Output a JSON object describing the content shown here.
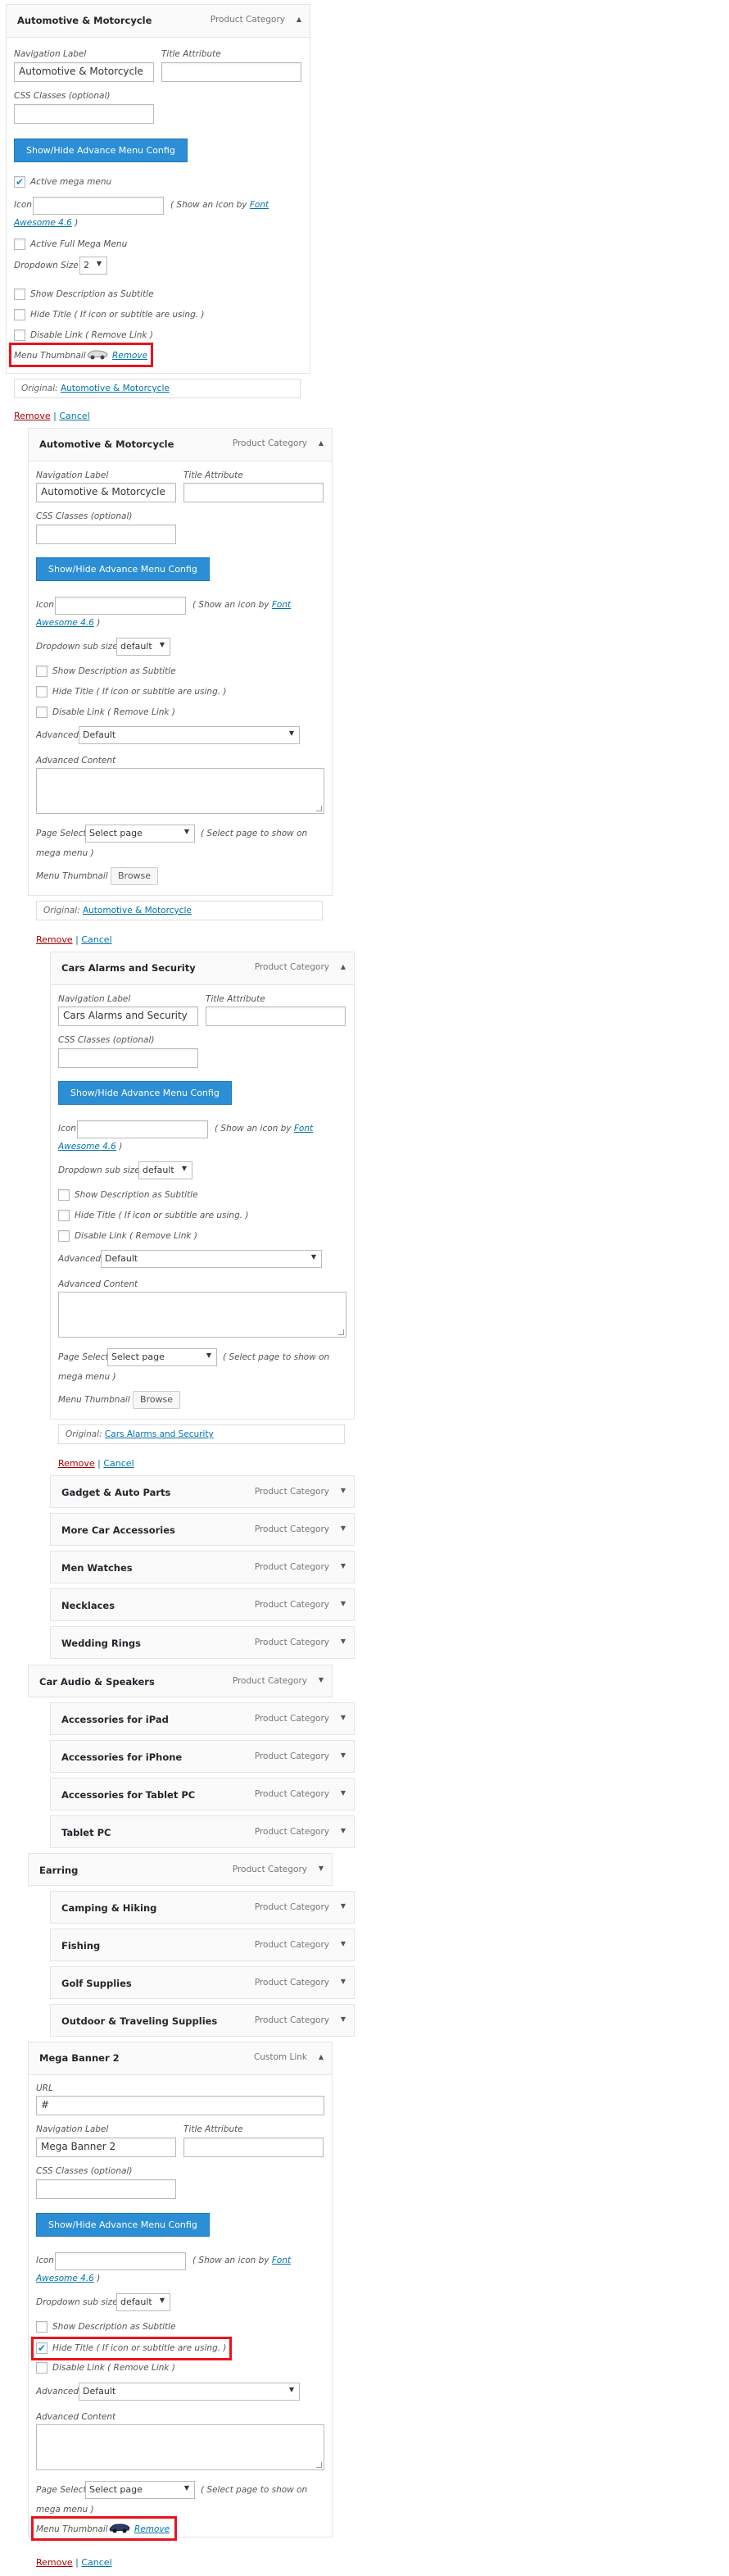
{
  "item1": {
    "title": "Automotive & Motorcycle",
    "type": "Product Category",
    "nav_label_caption": "Navigation Label",
    "nav_label_value": "Automotive & Motorcycle",
    "title_attr_caption": "Title Attribute",
    "css_caption": "CSS Classes (optional)",
    "config_button": "Show/Hide Advance Menu Config",
    "active_mega": "Active mega menu",
    "icon_caption": "Icon",
    "icon_hint_pre": "( Show an icon by",
    "icon_hint_link1": "Font",
    "icon_hint_link2": "Awesome 4.6",
    "icon_hint_post": ")",
    "active_full": "Active Full Mega Menu",
    "dropdown_size_caption": "Dropdown Size",
    "dropdown_size_value": "2",
    "show_desc": "Show Description as Subtitle",
    "hide_title": "Hide Title ( If icon or subtitle are using. )",
    "disable_link": "Disable Link ( Remove Link )",
    "thumb_caption": "Menu Thumbnail",
    "thumb_remove": "Remove",
    "original_caption": "Original:",
    "original_link": "Automotive & Motorcycle",
    "remove": "Remove",
    "sep": "|",
    "cancel": "Cancel"
  },
  "item2": {
    "title": "Automotive & Motorcycle",
    "type": "Product Category",
    "nav_label_caption": "Navigation Label",
    "nav_label_value": "Automotive & Motorcycle",
    "title_attr_caption": "Title Attribute",
    "css_caption": "CSS Classes (optional)",
    "config_button": "Show/Hide Advance Menu Config",
    "icon_caption": "Icon",
    "icon_hint_pre": "( Show an icon by",
    "icon_hint_link1": "Font",
    "icon_hint_link2": "Awesome 4.6",
    "icon_hint_post": ")",
    "dropdown_sub_caption": "Dropdown sub size",
    "dropdown_sub_value": "default",
    "show_desc": "Show Description as Subtitle",
    "hide_title": "Hide Title ( If icon or subtitle are using. )",
    "disable_link": "Disable Link ( Remove Link )",
    "advanced_caption": "Advanced",
    "advanced_value": "Default",
    "adv_content_caption": "Advanced Content",
    "page_select_caption": "Page Select",
    "page_select_value": "Select page",
    "page_select_hint1": "( Select page to show on",
    "page_select_hint2": "mega menu )",
    "thumb_caption": "Menu Thumbnail",
    "browse": "Browse",
    "original_caption": "Original:",
    "original_link": "Automotive & Motorcycle",
    "remove": "Remove",
    "sep": "|",
    "cancel": "Cancel"
  },
  "item3": {
    "title": "Cars Alarms and Security",
    "type": "Product Category",
    "nav_label_caption": "Navigation Label",
    "nav_label_value": "Cars Alarms and Security",
    "title_attr_caption": "Title Attribute",
    "css_caption": "CSS Classes (optional)",
    "config_button": "Show/Hide Advance Menu Config",
    "icon_caption": "Icon",
    "icon_hint_pre": "( Show an icon by",
    "icon_hint_link1": "Font",
    "icon_hint_link2": "Awesome 4.6",
    "icon_hint_post": ")",
    "dropdown_sub_caption": "Dropdown sub size",
    "dropdown_sub_value": "default",
    "show_desc": "Show Description as Subtitle",
    "hide_title": "Hide Title ( If icon or subtitle are using. )",
    "disable_link": "Disable Link ( Remove Link )",
    "advanced_caption": "Advanced",
    "advanced_value": "Default",
    "adv_content_caption": "Advanced Content",
    "page_select_caption": "Page Select",
    "page_select_value": "Select page",
    "page_select_hint1": "( Select page to show on",
    "page_select_hint2": "mega menu )",
    "thumb_caption": "Menu Thumbnail",
    "browse": "Browse",
    "original_caption": "Original:",
    "original_link": "Cars Alarms and Security",
    "remove": "Remove",
    "sep": "|",
    "cancel": "Cancel"
  },
  "collapsed": [
    {
      "title": "Gadget & Auto Parts",
      "type": "Product Category"
    },
    {
      "title": "More Car Accessories",
      "type": "Product Category"
    },
    {
      "title": "Men Watches",
      "type": "Product Category"
    },
    {
      "title": "Necklaces",
      "type": "Product Category"
    },
    {
      "title": "Wedding Rings",
      "type": "Product Category"
    },
    {
      "title": "Car Audio & Speakers",
      "type": "Product Category"
    },
    {
      "title": "Accessories for iPad",
      "type": "Product Category"
    },
    {
      "title": "Accessories for iPhone",
      "type": "Product Category"
    },
    {
      "title": "Accessories for Tablet PC",
      "type": "Product Category"
    },
    {
      "title": "Tablet PC",
      "type": "Product Category"
    },
    {
      "title": "Earring",
      "type": "Product Category"
    },
    {
      "title": "Camping & Hiking",
      "type": "Product Category"
    },
    {
      "title": "Fishing",
      "type": "Product Category"
    },
    {
      "title": "Golf Supplies",
      "type": "Product Category"
    },
    {
      "title": "Outdoor & Traveling Supplies",
      "type": "Product Category"
    }
  ],
  "item4": {
    "title": "Mega Banner 2",
    "type": "Custom Link",
    "url_caption": "URL",
    "url_value": "#",
    "nav_label_caption": "Navigation Label",
    "nav_label_value": "Mega Banner 2",
    "title_attr_caption": "Title Attribute",
    "css_caption": "CSS Classes (optional)",
    "config_button": "Show/Hide Advance Menu Config",
    "icon_caption": "Icon",
    "icon_hint_pre": "( Show an icon by",
    "icon_hint_link1": "Font",
    "icon_hint_link2": "Awesome 4.6",
    "icon_hint_post": ")",
    "dropdown_sub_caption": "Dropdown sub size",
    "dropdown_sub_value": "default",
    "show_desc": "Show Description as Subtitle",
    "hide_title": "Hide Title ( If icon or subtitle are using. )",
    "disable_link": "Disable Link ( Remove Link )",
    "advanced_caption": "Advanced",
    "advanced_value": "Default",
    "adv_content_caption": "Advanced Content",
    "page_select_caption": "Page Select",
    "page_select_value": "Select page",
    "page_select_hint1": "( Select page to show on",
    "page_select_hint2": "mega menu )",
    "thumb_caption": "Menu Thumbnail",
    "thumb_remove": "Remove",
    "remove": "Remove",
    "sep": "|",
    "cancel": "Cancel"
  }
}
